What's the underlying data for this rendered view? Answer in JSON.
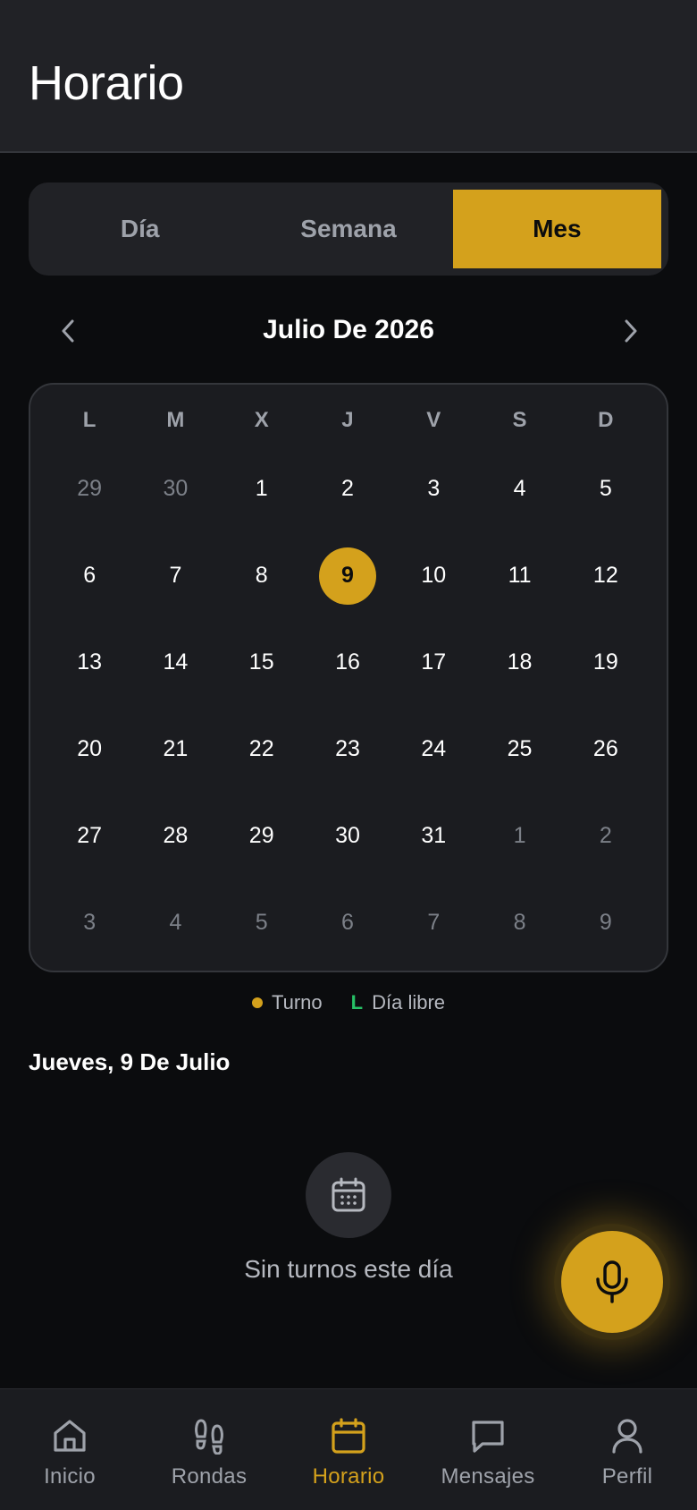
{
  "header": {
    "title": "Horario"
  },
  "view_switch": {
    "options": [
      {
        "label": "Día",
        "active": false
      },
      {
        "label": "Semana",
        "active": false
      },
      {
        "label": "Mes",
        "active": true
      }
    ]
  },
  "month_nav": {
    "title": "Julio De 2026",
    "prev_icon": "chevron-left-icon",
    "next_icon": "chevron-right-icon"
  },
  "calendar": {
    "weekdays": [
      "L",
      "M",
      "X",
      "J",
      "V",
      "S",
      "D"
    ],
    "weeks": [
      [
        {
          "d": "29",
          "other": true
        },
        {
          "d": "30",
          "other": true
        },
        {
          "d": "1"
        },
        {
          "d": "2"
        },
        {
          "d": "3"
        },
        {
          "d": "4"
        },
        {
          "d": "5"
        }
      ],
      [
        {
          "d": "6"
        },
        {
          "d": "7"
        },
        {
          "d": "8"
        },
        {
          "d": "9",
          "today": true
        },
        {
          "d": "10"
        },
        {
          "d": "11"
        },
        {
          "d": "12"
        }
      ],
      [
        {
          "d": "13"
        },
        {
          "d": "14"
        },
        {
          "d": "15"
        },
        {
          "d": "16"
        },
        {
          "d": "17"
        },
        {
          "d": "18"
        },
        {
          "d": "19"
        }
      ],
      [
        {
          "d": "20"
        },
        {
          "d": "21"
        },
        {
          "d": "22"
        },
        {
          "d": "23"
        },
        {
          "d": "24"
        },
        {
          "d": "25"
        },
        {
          "d": "26"
        }
      ],
      [
        {
          "d": "27"
        },
        {
          "d": "28"
        },
        {
          "d": "29"
        },
        {
          "d": "30"
        },
        {
          "d": "31"
        },
        {
          "d": "1",
          "other": true
        },
        {
          "d": "2",
          "other": true
        }
      ],
      [
        {
          "d": "3",
          "other": true
        },
        {
          "d": "4",
          "other": true
        },
        {
          "d": "5",
          "other": true
        },
        {
          "d": "6",
          "other": true
        },
        {
          "d": "7",
          "other": true
        },
        {
          "d": "8",
          "other": true
        },
        {
          "d": "9",
          "other": true
        }
      ]
    ]
  },
  "legend": {
    "shift_label": "Turno",
    "day_off_marker": "L",
    "day_off_label": "Día libre"
  },
  "selected_day": {
    "title": "Jueves, 9 De Julio"
  },
  "empty_state": {
    "icon": "calendar-icon",
    "text": "Sin turnos este día"
  },
  "fab": {
    "icon": "microphone-icon"
  },
  "bottom_nav": {
    "tabs": [
      {
        "label": "Inicio",
        "icon": "home-icon",
        "active": false
      },
      {
        "label": "Rondas",
        "icon": "footprints-icon",
        "active": false
      },
      {
        "label": "Horario",
        "icon": "calendar-icon",
        "active": true
      },
      {
        "label": "Mensajes",
        "icon": "message-icon",
        "active": false
      },
      {
        "label": "Perfil",
        "icon": "user-icon",
        "active": false
      }
    ]
  },
  "colors": {
    "accent": "#d4a11c",
    "background": "#0b0c0e",
    "surface": "#212226",
    "day_off": "#27c066"
  }
}
